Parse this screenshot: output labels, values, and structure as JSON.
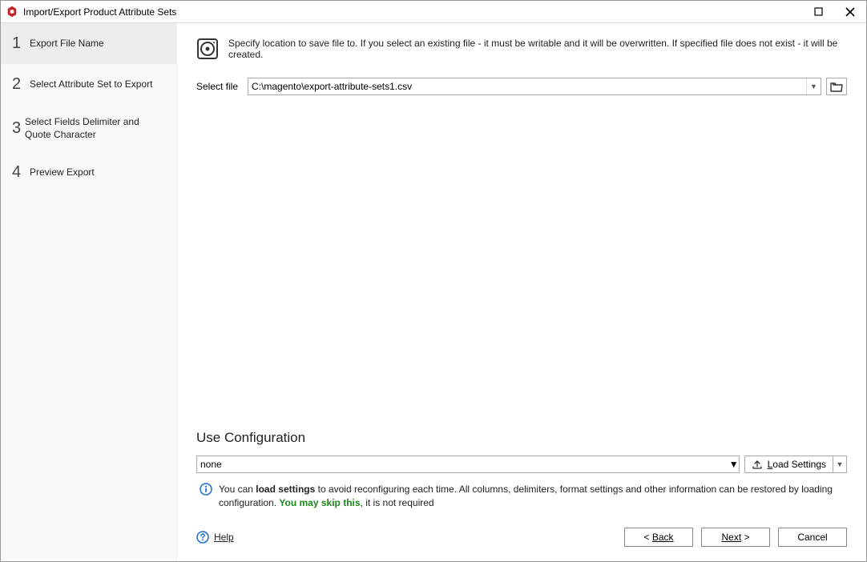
{
  "window": {
    "title": "Import/Export Product Attribute Sets"
  },
  "sidebar": {
    "steps": [
      {
        "num": "1",
        "label": "Export File Name"
      },
      {
        "num": "2",
        "label": "Select Attribute Set to Export"
      },
      {
        "num": "3",
        "label": "Select Fields Delimiter and Quote Character"
      },
      {
        "num": "4",
        "label": "Preview Export"
      }
    ]
  },
  "main": {
    "instruction": "Specify location to save file to. If you select an existing file - it must be writable and it will be overwritten. If specified file does not exist - it will be created.",
    "select_file_label": "Select file",
    "file_path": "C:\\magento\\export-attribute-sets1.csv"
  },
  "config": {
    "title": "Use Configuration",
    "selected": "none",
    "load_btn": "Load Settings",
    "note_pre": "You can ",
    "note_bold": "load settings",
    "note_mid": " to avoid reconfiguring each time. All columns, delimiters, format settings and other information can be restored by loading configuration. ",
    "note_green": "You may skip this",
    "note_post": ", it is not required"
  },
  "footer": {
    "help": "Help",
    "back": "Back",
    "next": "Next",
    "cancel": "Cancel"
  }
}
